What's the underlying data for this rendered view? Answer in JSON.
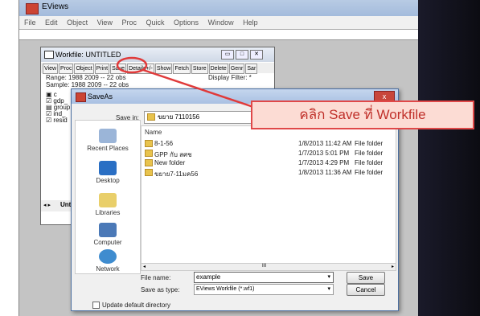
{
  "app": {
    "title": "EViews"
  },
  "menu": [
    "File",
    "Edit",
    "Object",
    "View",
    "Proc",
    "Quick",
    "Options",
    "Window",
    "Help"
  ],
  "workfile": {
    "title": "Workfile: UNTITLED",
    "toolbar": [
      "View",
      "Proc",
      "Object",
      "Print",
      "Save",
      "Details+/-",
      "Show",
      "Fetch",
      "Store",
      "Delete",
      "Genr",
      "Sar"
    ],
    "range": "Range:  1988 2009  --  22 obs",
    "sample": "Sample: 1988 2009  --  22 obs",
    "display_filter": "Display Filter: *",
    "items": [
      "c",
      "gdp_",
      "group",
      "ind_",
      "resid"
    ],
    "tab": "Unt"
  },
  "dialog": {
    "title": "SaveAs",
    "close": "x",
    "save_in_label": "Save in:",
    "save_in_value": "ขยาย 7110156",
    "column_name": "Name",
    "places": [
      "Recent Places",
      "Desktop",
      "Libraries",
      "Computer",
      "Network"
    ],
    "files": [
      {
        "name": "8-1-56",
        "date": "1/8/2013 11:42 AM",
        "type": "File folder"
      },
      {
        "name": "GPP กับ สศช",
        "date": "1/7/2013 5:01 PM",
        "type": "File folder"
      },
      {
        "name": "New folder",
        "date": "1/7/2013 4:29 PM",
        "type": "File folder"
      },
      {
        "name": "ขยาย7-11มค56",
        "date": "1/8/2013 11:36 AM",
        "type": "File folder"
      }
    ],
    "scroll_thumb": "III",
    "file_name_label": "File name:",
    "file_name_value": "example",
    "save_as_type_label": "Save as type:",
    "save_as_type_value": "EViews Workfile (*.wf1)",
    "save_button": "Save",
    "cancel_button": "Cancel",
    "update_checkbox": "Update default directory"
  },
  "callout": {
    "text": "คลิก Save ที่ Workfile"
  },
  "colors": {
    "annotation": "#e03a3a",
    "callout_bg": "#fcdcd4"
  }
}
